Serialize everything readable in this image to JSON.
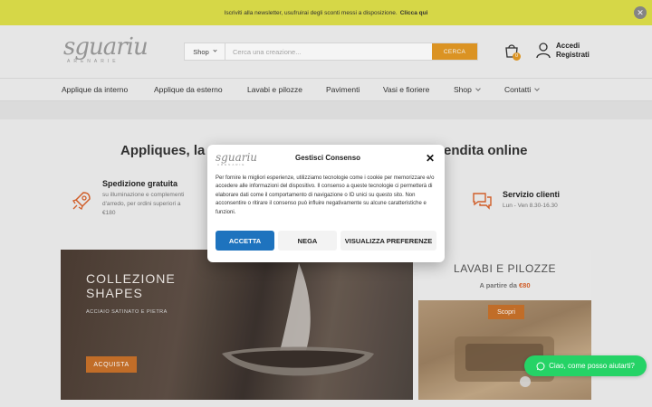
{
  "topbar": {
    "message": "Iscriviti alla newsletter, usufruirai degli sconti messi a disposizione.",
    "link": "Clicca qui"
  },
  "header": {
    "logo_main": "sguariu",
    "logo_sub": "ARENARIE",
    "search": {
      "category": "Shop",
      "placeholder": "Cerca una creazione...",
      "button": "CERCA"
    },
    "cart_count": "0",
    "account_line1": "Accedi",
    "account_line2": "Registrati"
  },
  "nav": {
    "items": [
      {
        "label": "Applique da interno"
      },
      {
        "label": "Applique da esterno"
      },
      {
        "label": "Lavabi e pilozze"
      },
      {
        "label": "Pavimenti"
      },
      {
        "label": "Vasi e fioriere"
      },
      {
        "label": "Shop"
      },
      {
        "label": "Contatti"
      }
    ]
  },
  "headline": {
    "left": "Appliques, la",
    "right": "endita online"
  },
  "features": [
    {
      "title": "Spedizione gratuita",
      "desc": "su illuminazione e complementi d'arredo, per ordini superiori a €180"
    },
    {
      "title": "Servizio clienti",
      "desc": "Lun - Ven 8.30-16.30"
    }
  ],
  "banner_left": {
    "title": "COLLEZIONE SHAPES",
    "subtitle": "ACCIAIO SATINATO E PIETRA",
    "button": "ACQUISTA"
  },
  "banner_right": {
    "title": "LAVABI E PILOZZE",
    "price_prefix": "A partire da",
    "price": "€80",
    "button": "Scopri"
  },
  "modal": {
    "logo_main": "sguariu",
    "logo_sub": "ARENARIE",
    "title": "Gestisci Consenso",
    "text": "Per fornire le migliori esperienze, utilizziamo tecnologie come i cookie per memorizzare e/o accedere alle informazioni del dispositivo. Il consenso a queste tecnologie ci permetterà di elaborare dati come il comportamento di navigazione o ID unici su questo sito. Non acconsentire o ritirare il consenso può influire negativamente su alcune caratteristiche e funzioni.",
    "accept": "ACCETTA",
    "deny": "NEGA",
    "preferences": "VISUALIZZA PREFERENZE"
  },
  "chat": {
    "label": "Ciao, come posso aiutarti?"
  },
  "colors": {
    "topbar_bg": "#dfe04a",
    "accent_orange": "#e49a25",
    "accept_blue": "#1e73be",
    "whatsapp_green": "#25d366"
  }
}
